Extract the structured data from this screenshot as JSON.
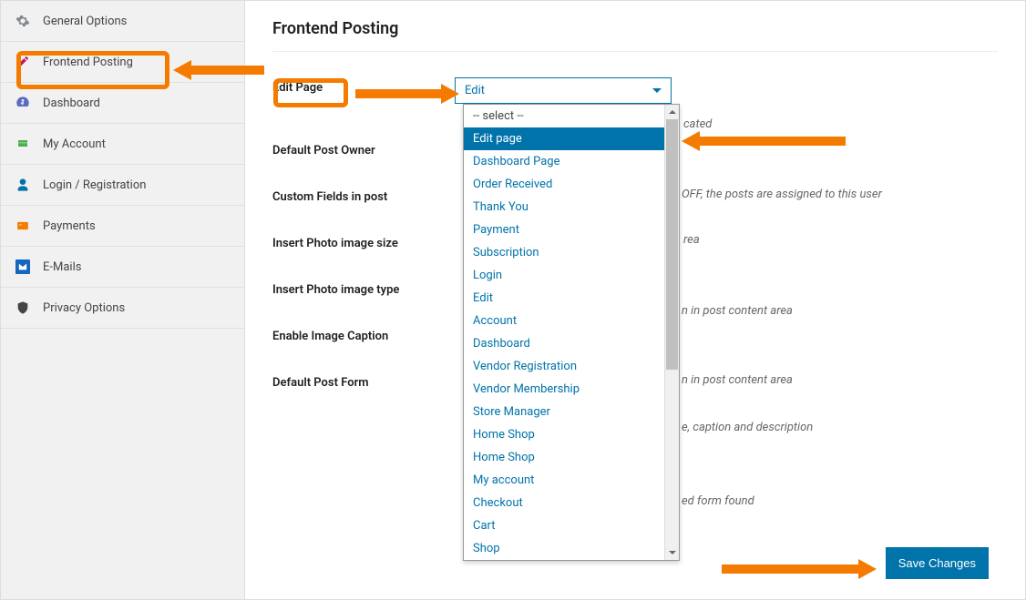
{
  "sidebar": {
    "items": [
      {
        "label": "General Options",
        "icon": "gear"
      },
      {
        "label": "Frontend Posting",
        "icon": "edit"
      },
      {
        "label": "Dashboard",
        "icon": "dashboard"
      },
      {
        "label": "My Account",
        "icon": "account"
      },
      {
        "label": "Login / Registration",
        "icon": "user"
      },
      {
        "label": "Payments",
        "icon": "payment"
      },
      {
        "label": "E-Mails",
        "icon": "mail"
      },
      {
        "label": "Privacy Options",
        "icon": "shield"
      }
    ]
  },
  "page": {
    "title": "Frontend Posting"
  },
  "form": {
    "edit_page_label": "Edit Page",
    "edit_page_value": "Edit",
    "edit_page_hint": "cated",
    "default_owner_label": "Default Post Owner",
    "default_owner_hint": "OFF, the posts are assigned to this user",
    "custom_fields_label": "Custom Fields in post",
    "custom_fields_hint": "rea",
    "photo_size_label": "Insert Photo image size",
    "photo_size_hint": "n in post content area",
    "photo_type_label": "Insert Photo image type",
    "photo_type_hint": "n in post content area",
    "img_caption_label": "Enable Image Caption",
    "img_caption_hint": "e, caption and description",
    "default_form_label": "Default Post Form",
    "default_form_hint": "ed form found"
  },
  "dropdown": {
    "placeholder": "-- select --",
    "options": [
      "Edit page",
      "Dashboard Page",
      "Order Received",
      "Thank You",
      "Payment",
      "Subscription",
      "Login",
      "Edit",
      "Account",
      "Dashboard",
      "Vendor Registration",
      "Vendor Membership",
      "Store Manager",
      "Home Shop",
      "Home Shop",
      "My account",
      "Checkout",
      "Cart",
      "Shop"
    ],
    "selected": "Edit page"
  },
  "buttons": {
    "save": "Save Changes"
  },
  "annotation_color": "#f47b00"
}
